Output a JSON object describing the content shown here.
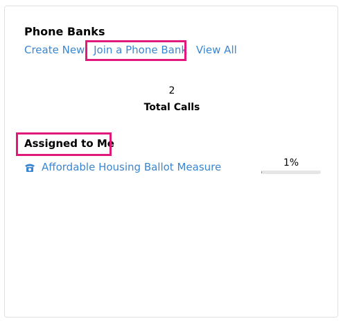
{
  "widget": {
    "title": "Phone Banks",
    "actions": {
      "create_new": "Create New",
      "join": "Join a Phone Bank",
      "view_all": "View All"
    },
    "stats": {
      "total_calls_value": "2",
      "total_calls_label": "Total Calls"
    },
    "assigned": {
      "heading": "Assigned to Me",
      "items": [
        {
          "name": "Affordable Housing Ballot Measure",
          "icon": "phone-icon",
          "progress_text": "1%",
          "progress_fraction": 0.01
        }
      ]
    }
  },
  "colors": {
    "link": "#3a86d0",
    "highlight": "#e0177c",
    "progress_track": "#e6e6e6"
  }
}
